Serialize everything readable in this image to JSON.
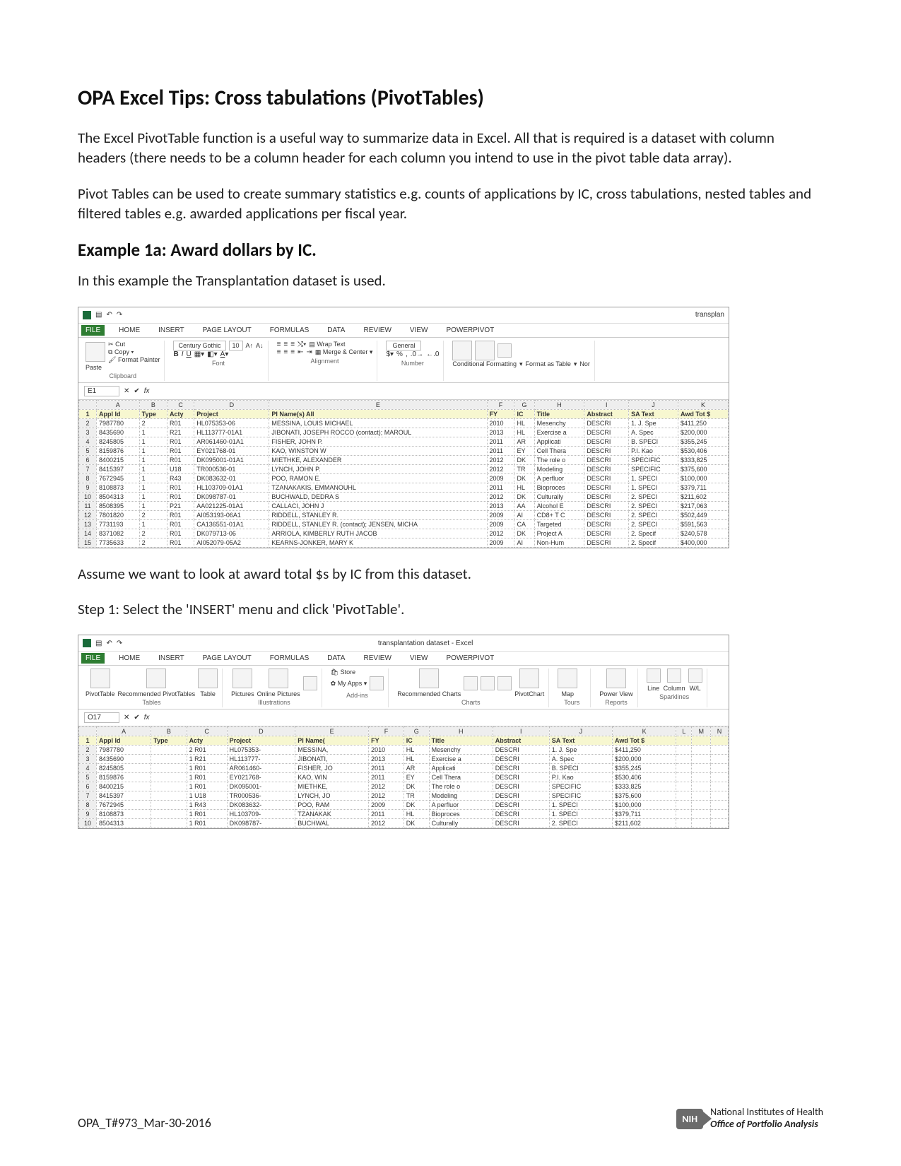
{
  "title": "OPA Excel Tips: Cross tabulations (PivotTables)",
  "para1": "The Excel PivotTable function is a useful way to summarize data in Excel.  All that is required is a dataset with column headers (there needs to be a column header for each column you intend to use in the pivot table data array).",
  "para2": "Pivot Tables can be used to create summary statistics e.g. counts of applications by IC, cross tabulations, nested tables and filtered tables e.g. awarded applications per fiscal year.",
  "example_heading": "Example 1a: Award dollars by IC.",
  "example_intro": "In this example the Transplantation dataset is used.",
  "assume_line": "Assume we want to look at award total $s by IC from this dataset.",
  "step1": "Step 1: Select the 'INSERT' menu and click 'PivotTable'.",
  "footer_id": "OPA_T#973_Mar-30-2016",
  "nih_badge": "NIH",
  "nih_l1": "National Institutes of Health",
  "nih_l2": "Office of Portfolio Analysis",
  "excel1": {
    "title_right": "transplan",
    "tabs": [
      "FILE",
      "HOME",
      "INSERT",
      "PAGE LAYOUT",
      "FORMULAS",
      "DATA",
      "REVIEW",
      "VIEW",
      "POWERPIVOT"
    ],
    "active_tab": "FILE",
    "clipboard": {
      "cut": "Cut",
      "copy": "Copy",
      "fmtpainter": "Format Painter",
      "group": "Clipboard",
      "paste": "Paste"
    },
    "fontgroup": {
      "font": "Century Gothic",
      "size": "10",
      "group": "Font"
    },
    "align": {
      "wrap": "Wrap Text",
      "merge": "Merge & Center",
      "group": "Alignment"
    },
    "number": {
      "general": "General",
      "group": "Number"
    },
    "styles": {
      "cf": "Conditional Formatting",
      "fat": "Format as Table",
      "nor": "Nor"
    },
    "cellref": "E1",
    "cols": [
      "",
      "A",
      "B",
      "C",
      "D",
      "E",
      "F",
      "G",
      "H",
      "I",
      "J",
      "K"
    ],
    "hdr": [
      "1",
      "Appl Id",
      "Type",
      "Acty",
      "Project",
      "PI Name(s) All",
      "FY",
      "IC",
      "Title",
      "Abstract",
      "SA Text",
      "Awd Tot $"
    ],
    "rows": [
      [
        "2",
        "7987780",
        "2",
        "R01",
        "HL075353-06",
        "MESSINA, LOUIS MICHAEL",
        "2010",
        "HL",
        "Mesenchy",
        "DESCRI",
        "1. J. Spe",
        "$411,250"
      ],
      [
        "3",
        "8435690",
        "1",
        "R21",
        "HL113777-01A1",
        "JIBONATI, JOSEPH ROCCO (contact); MAROUL",
        "2013",
        "HL",
        "Exercise a",
        "DESCRI",
        "A. Spec",
        "$200,000"
      ],
      [
        "4",
        "8245805",
        "1",
        "R01",
        "AR061460-01A1",
        "FISHER, JOHN P.",
        "2011",
        "AR",
        "Applicati",
        "DESCRI",
        "B. SPECI",
        "$355,245"
      ],
      [
        "5",
        "8159876",
        "1",
        "R01",
        "EY021768-01",
        "KAO, WINSTON W",
        "2011",
        "EY",
        "Cell Thera",
        "DESCRI",
        "P.I. Kao",
        "$530,406"
      ],
      [
        "6",
        "8400215",
        "1",
        "R01",
        "DK095001-01A1",
        "MIETHKE, ALEXANDER",
        "2012",
        "DK",
        "The role o",
        "DESCRI",
        "SPECIFIC",
        "$333,825"
      ],
      [
        "7",
        "8415397",
        "1",
        "U18",
        "TR000536-01",
        "LYNCH, JOHN P.",
        "2012",
        "TR",
        "Modeling",
        "DESCRI",
        "SPECIFIC",
        "$375,600"
      ],
      [
        "8",
        "7672945",
        "1",
        "R43",
        "DK083632-01",
        "POO, RAMON E.",
        "2009",
        "DK",
        "A perfluor",
        "DESCRI",
        "1. SPECI",
        "$100,000"
      ],
      [
        "9",
        "8108873",
        "1",
        "R01",
        "HL103709-01A1",
        "TZANAKAKIS, EMMANOUHL",
        "2011",
        "HL",
        "Bioproces",
        "DESCRI",
        "1. SPECI",
        "$379,711"
      ],
      [
        "10",
        "8504313",
        "1",
        "R01",
        "DK098787-01",
        "BUCHWALD, DEDRA S",
        "2012",
        "DK",
        "Culturally",
        "DESCRI",
        "2. SPECI",
        "$211,602"
      ],
      [
        "11",
        "8508395",
        "1",
        "P21",
        "AA021225-01A1",
        "CALLACI, JOHN J",
        "2013",
        "AA",
        "Alcohol E",
        "DESCRI",
        "2. SPECI",
        "$217,063"
      ],
      [
        "12",
        "7801820",
        "2",
        "R01",
        "AI053193-06A1",
        "RIDDELL, STANLEY R.",
        "2009",
        "AI",
        "CD8+ T C",
        "DESCRI",
        "2. SPECI",
        "$502,449"
      ],
      [
        "13",
        "7731193",
        "1",
        "R01",
        "CA136551-01A1",
        "RIDDELL, STANLEY R. (contact); JENSEN, MICHA",
        "2009",
        "CA",
        "Targeted",
        "DESCRI",
        "2. SPECI",
        "$591,563"
      ],
      [
        "14",
        "8371082",
        "2",
        "R01",
        "DK079713-06",
        "ARRIOLA, KIMBERLY RUTH JACOB",
        "2012",
        "DK",
        "Project A",
        "DESCRI",
        "2. Specif",
        "$240,578"
      ],
      [
        "15",
        "7735633",
        "2",
        "R01",
        "AI052079-05A2",
        "KEARNS-JONKER, MARY K",
        "2009",
        "AI",
        "Non-Hum",
        "DESCRI",
        "2. Specif",
        "$400,000"
      ]
    ]
  },
  "excel2": {
    "title_center": "transplantation dataset - Excel",
    "tabs": [
      "FILE",
      "HOME",
      "INSERT",
      "PAGE LAYOUT",
      "FORMULAS",
      "DATA",
      "REVIEW",
      "VIEW",
      "POWERPIVOT"
    ],
    "active_tab": "FILE",
    "ribbon_items": {
      "pivottable": "PivotTable",
      "recpt": "Recommended PivotTables",
      "table": "Table",
      "pictures": "Pictures",
      "onlinepics": "Online Pictures",
      "store": "Store",
      "myapps": "My Apps",
      "reccharts": "Recommended Charts",
      "pivotchart": "PivotChart",
      "map": "Map",
      "powerview": "Power View",
      "line": "Line",
      "column": "Column",
      "wl": "W/L"
    },
    "ribbon_groups": {
      "tables": "Tables",
      "illus": "Illustrations",
      "addins": "Add-ins",
      "charts": "Charts",
      "tours": "Tours",
      "reports": "Reports",
      "spark": "Sparklines"
    },
    "cellref": "O17",
    "cols": [
      "",
      "A",
      "B",
      "C",
      "D",
      "E",
      "F",
      "G",
      "H",
      "I",
      "J",
      "K",
      "L",
      "M",
      "N"
    ],
    "hdr": [
      "1",
      "Appl Id",
      "Type",
      "Acty",
      "Project",
      "PI Name(",
      "FY",
      "IC",
      "Title",
      "Abstract",
      "SA Text",
      "Awd Tot $",
      "",
      "",
      ""
    ],
    "rows": [
      [
        "2",
        "7987780",
        "",
        "2 R01",
        "HL075353-",
        "MESSINA,",
        "2010",
        "HL",
        "Mesenchy",
        "DESCRI",
        "1. J. Spe",
        "$411,250",
        "",
        "",
        ""
      ],
      [
        "3",
        "8435690",
        "",
        "1 R21",
        "HL113777-",
        "JIBONATI,",
        "2013",
        "HL",
        "Exercise a",
        "DESCRI",
        "A. Spec",
        "$200,000",
        "",
        "",
        ""
      ],
      [
        "4",
        "8245805",
        "",
        "1 R01",
        "AR061460-",
        "FISHER, JO",
        "2011",
        "AR",
        "Applicati",
        "DESCRI",
        "B. SPECI",
        "$355,245",
        "",
        "",
        ""
      ],
      [
        "5",
        "8159876",
        "",
        "1 R01",
        "EY021768-",
        "KAO, WIN",
        "2011",
        "EY",
        "Cell Thera",
        "DESCRI",
        "P.I. Kao",
        "$530,406",
        "",
        "",
        ""
      ],
      [
        "6",
        "8400215",
        "",
        "1 R01",
        "DK095001-",
        "MIETHKE,",
        "2012",
        "DK",
        "The role o",
        "DESCRI",
        "SPECIFIC",
        "$333,825",
        "",
        "",
        ""
      ],
      [
        "7",
        "8415397",
        "",
        "1 U18",
        "TR000536-",
        "LYNCH, JO",
        "2012",
        "TR",
        "Modeling",
        "DESCRI",
        "SPECIFIC",
        "$375,600",
        "",
        "",
        ""
      ],
      [
        "8",
        "7672945",
        "",
        "1 R43",
        "DK083632-",
        "POO, RAM",
        "2009",
        "DK",
        "A perfluor",
        "DESCRI",
        "1. SPECI",
        "$100,000",
        "",
        "",
        ""
      ],
      [
        "9",
        "8108873",
        "",
        "1 R01",
        "HL103709-",
        "TZANAKAK",
        "2011",
        "HL",
        "Bioproces",
        "DESCRI",
        "1. SPECI",
        "$379,711",
        "",
        "",
        ""
      ],
      [
        "10",
        "8504313",
        "",
        "1 R01",
        "DK098787-",
        "BUCHWAL",
        "2012",
        "DK",
        "Culturally",
        "DESCRI",
        "2. SPECI",
        "$211,602",
        "",
        "",
        ""
      ]
    ]
  }
}
